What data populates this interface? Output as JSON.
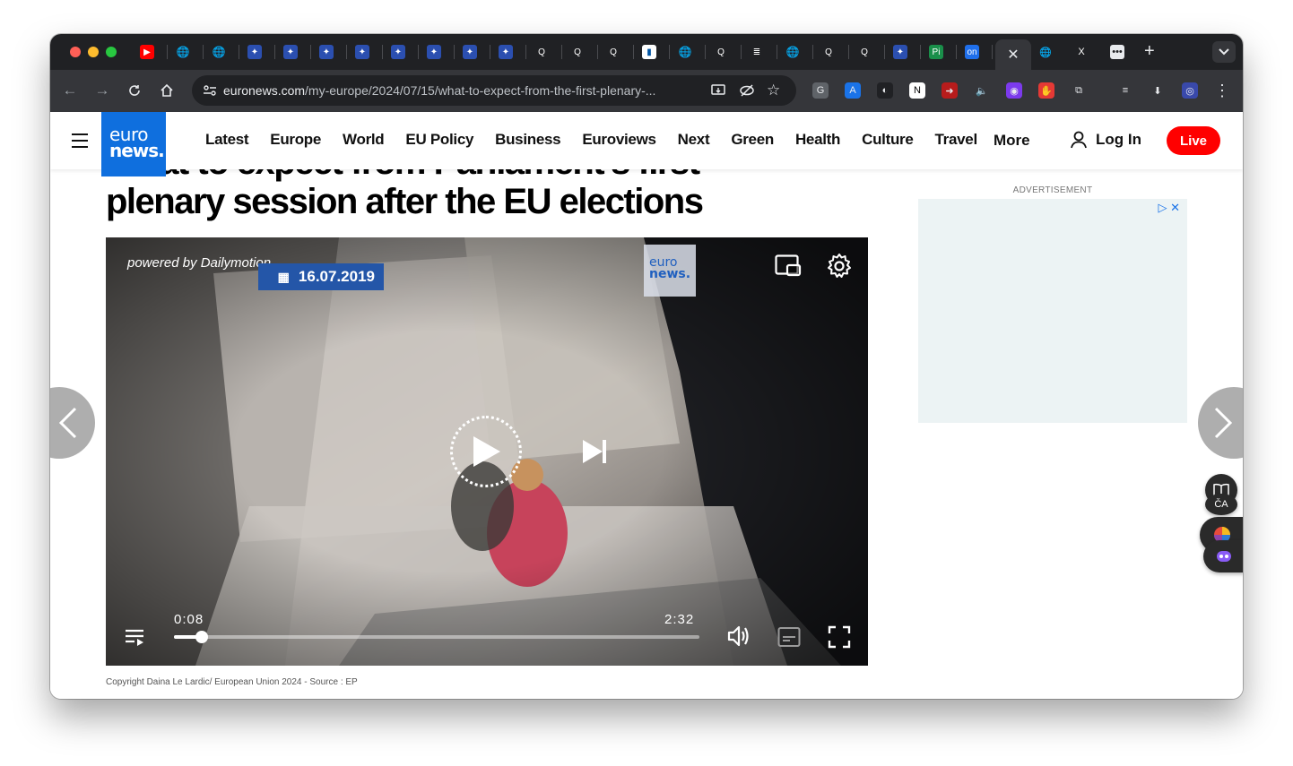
{
  "browser": {
    "tab_icons": [
      "youtube-icon",
      "globe-icon",
      "globe-icon",
      "eu-flag-icon",
      "eu-flag-icon",
      "eu-flag-icon",
      "eu-flag-icon",
      "eu-flag-icon",
      "eu-flag-icon",
      "eu-flag-icon",
      "eu-flag-icon",
      "q-icon",
      "q-icon",
      "q-icon",
      "france-flag-icon",
      "globe-icon",
      "q-icon",
      "doc-icon",
      "globe-icon",
      "q-icon",
      "q-icon",
      "eu-flag-icon",
      "pi-icon",
      "on-icon"
    ],
    "active_tab_close": "✕",
    "after_tabs": [
      "globe-icon",
      "x-icon",
      "dots-icon"
    ],
    "new_tab": "+",
    "tab_dropdown": "⌄",
    "url_host": "euronews.com",
    "url_path": "/my-europe/2024/07/15/what-to-expect-from-the-first-plenary-...",
    "extensions": [
      "G",
      "A",
      "◐",
      "N",
      "➜",
      "🔈",
      "◉",
      "✋",
      "⧉",
      "≡",
      "⬇",
      "◎",
      "⋮"
    ]
  },
  "site": {
    "logo_line1": "euro",
    "logo_line2": "news.",
    "nav": [
      "Latest",
      "Europe",
      "World",
      "EU Policy",
      "Business",
      "Euroviews",
      "Next",
      "Green",
      "Health",
      "Culture",
      "Travel"
    ],
    "more": "More",
    "login": "Log In",
    "live": "Live"
  },
  "article": {
    "headline_line1": "What to expect from Parliament's first",
    "headline_line2": "plenary session after the EU elections",
    "caption": "Copyright Daina Le Lardic/ European Union 2024 - Source : EP"
  },
  "player": {
    "powered_by": "powered by Dailymotion",
    "date_badge": "16.07.2019",
    "watermark_line1": "euro",
    "watermark_line2": "news.",
    "current_time": "0:08",
    "duration": "2:32",
    "progress": 0.053
  },
  "ad": {
    "label": "ADVERTISEMENT"
  },
  "colors": {
    "brand_blue": "#0f6fde",
    "live_red": "#ff0000",
    "chrome_dark": "#202124",
    "chrome_toolbar": "#35363a"
  }
}
